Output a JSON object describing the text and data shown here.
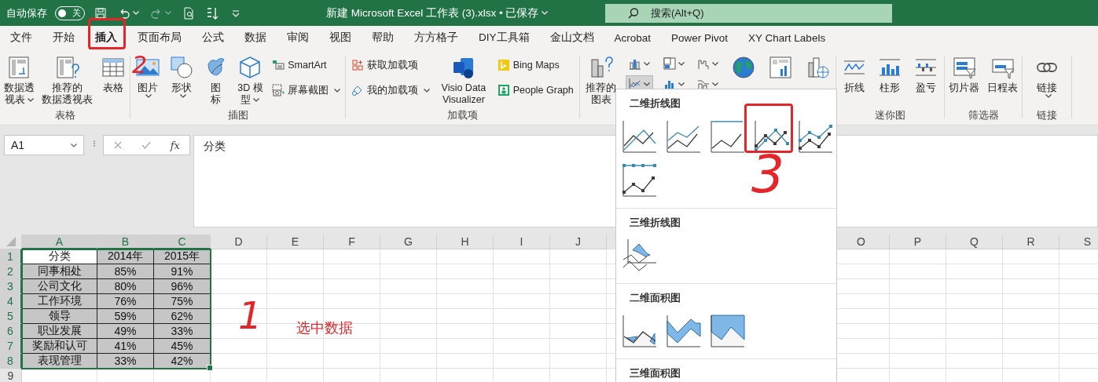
{
  "title_bar": {
    "autosave_label": "自动保存",
    "autosave": {
      "on": false,
      "label": "关"
    },
    "quick_access": [
      {
        "kind": "save",
        "disabled": false
      },
      {
        "kind": "undo",
        "disabled": false
      },
      {
        "kind": "redo",
        "disabled": true
      },
      {
        "kind": "document",
        "disabled": false
      },
      {
        "kind": "sort",
        "disabled": false
      },
      {
        "kind": "customize",
        "disabled": false
      }
    ],
    "title": "新建 Microsoft Excel 工作表 (3).xlsx • 已保存",
    "search": {
      "placeholder": "搜索(Alt+Q)"
    }
  },
  "tabs": [
    {
      "label": "文件",
      "selected": false
    },
    {
      "label": "开始",
      "selected": false
    },
    {
      "label": "插入",
      "selected": true
    },
    {
      "label": "页面布局",
      "selected": false
    },
    {
      "label": "公式",
      "selected": false
    },
    {
      "label": "数据",
      "selected": false
    },
    {
      "label": "审阅",
      "selected": false
    },
    {
      "label": "视图",
      "selected": false
    },
    {
      "label": "帮助",
      "selected": false
    },
    {
      "label": "方方格子",
      "selected": false
    },
    {
      "label": "DIY工具箱",
      "selected": false
    },
    {
      "label": "金山文档",
      "selected": false
    },
    {
      "label": "Acrobat",
      "selected": false
    },
    {
      "label": "Power Pivot",
      "selected": false
    },
    {
      "label": "XY Chart Labels",
      "selected": false
    }
  ],
  "ribbon": {
    "groups": [
      {
        "label": "表格",
        "columns": [
          {
            "kind": "large",
            "lines": [
              "数据透",
              "视表"
            ],
            "dropdown": true
          },
          {
            "kind": "large",
            "lines": [
              "推荐的",
              "数据透视表"
            ]
          },
          {
            "kind": "large",
            "lines": [
              "表格"
            ]
          }
        ]
      },
      {
        "label": "插图",
        "columns": [
          {
            "kind": "large",
            "lines": [
              "图片"
            ],
            "dropdown": true
          },
          {
            "kind": "large",
            "lines": [
              "形状"
            ],
            "dropdown": true
          },
          {
            "kind": "large",
            "lines": [
              "图",
              "标"
            ]
          },
          {
            "kind": "large",
            "lines": [
              "3D 模",
              "型"
            ],
            "dropdown": true
          },
          {
            "kind": "stack",
            "items": [
              {
                "label": "SmartArt"
              },
              {
                "label": "屏幕截图",
                "dropdown": true
              }
            ]
          }
        ]
      },
      {
        "label": "加载项",
        "columns": [
          {
            "kind": "stack",
            "items": [
              {
                "label": "获取加载项"
              },
              {
                "label": "我的加载项",
                "dropdown": true
              }
            ]
          },
          {
            "kind": "large",
            "lines": [
              "Visio Data",
              "Visualizer"
            ]
          },
          {
            "kind": "stack",
            "items": [
              {
                "label": "Bing Maps"
              },
              {
                "label": "People Graph"
              }
            ]
          }
        ]
      },
      {
        "columns": [
          {
            "kind": "large",
            "lines": [
              "推荐的",
              "图表"
            ]
          },
          {
            "kind": "icons",
            "items": [
              {
                "pressed": false
              },
              {
                "pressed": true
              }
            ]
          },
          {
            "kind": "icons",
            "items": [
              {
                "pressed": false
              },
              {
                "pressed": false
              }
            ]
          },
          {
            "kind": "icons",
            "items": [
              {
                "pressed": false
              },
              {
                "pressed": false
              }
            ]
          },
          {
            "kind": "large"
          },
          {
            "kind": "large"
          },
          {
            "kind": "large"
          }
        ]
      },
      {
        "label": "迷你图",
        "columns": [
          {
            "kind": "large",
            "lines": [
              "折线"
            ]
          },
          {
            "kind": "large",
            "lines": [
              "柱形"
            ]
          },
          {
            "kind": "large",
            "lines": [
              "盈亏"
            ]
          }
        ]
      },
      {
        "label": "筛选器",
        "columns": [
          {
            "kind": "large",
            "lines": [
              "切片器"
            ]
          },
          {
            "kind": "large",
            "lines": [
              "日程表"
            ]
          }
        ]
      },
      {
        "label": "链接",
        "columns": [
          {
            "kind": "large",
            "lines": [
              "链接"
            ],
            "dropdown": true
          }
        ]
      }
    ]
  },
  "formula_bar": {
    "name_box": "A1",
    "function_label": "fx",
    "formula": "分类"
  },
  "sheet": {
    "columns": [
      {
        "label": "A",
        "selected": true
      },
      {
        "label": "B",
        "selected": true
      },
      {
        "label": "C",
        "selected": true
      },
      {
        "label": "D",
        "selected": false
      },
      {
        "label": "E",
        "selected": false
      },
      {
        "label": "F",
        "selected": false
      },
      {
        "label": "G",
        "selected": false
      },
      {
        "label": "H",
        "selected": false
      },
      {
        "label": "I",
        "selected": false
      },
      {
        "label": "J",
        "selected": false
      },
      {
        "label": "O",
        "selected": false
      },
      {
        "label": "P",
        "selected": false
      },
      {
        "label": "Q",
        "selected": false
      },
      {
        "label": "R",
        "selected": false
      },
      {
        "label": "S",
        "selected": false
      }
    ],
    "rows": [
      {
        "number": "1",
        "selected": true,
        "cells": [
          "分类",
          "2014年",
          "2015年"
        ]
      },
      {
        "number": "2",
        "selected": true,
        "cells": [
          "同事相处",
          "85%",
          "91%"
        ]
      },
      {
        "number": "3",
        "selected": true,
        "cells": [
          "公司文化",
          "80%",
          "96%"
        ]
      },
      {
        "number": "4",
        "selected": true,
        "cells": [
          "工作环境",
          "76%",
          "75%"
        ]
      },
      {
        "number": "5",
        "selected": true,
        "cells": [
          "领导",
          "59%",
          "62%"
        ]
      },
      {
        "number": "6",
        "selected": true,
        "cells": [
          "职业发展",
          "49%",
          "33%"
        ]
      },
      {
        "number": "7",
        "selected": true,
        "cells": [
          "奖励和认可",
          "41%",
          "45%"
        ]
      },
      {
        "number": "8",
        "selected": true,
        "cells": [
          "表现管理",
          "33%",
          "42%"
        ]
      },
      {
        "number": "9",
        "selected": false
      }
    ]
  },
  "chart_menu": {
    "sections": [
      {
        "title": "二维折线图",
        "options": [
          {
            "kind": "line"
          },
          {
            "kind": "stacked-line"
          },
          {
            "kind": "percent-line"
          },
          {
            "kind": "line-markers"
          },
          {
            "kind": "stacked-line-markers"
          },
          {
            "kind": "percent-line-markers"
          }
        ]
      },
      {
        "title": "三维折线图",
        "options": [
          {
            "kind": "line3d"
          }
        ]
      },
      {
        "title": "二维面积图",
        "options": [
          {
            "kind": "area"
          },
          {
            "kind": "stacked-area"
          },
          {
            "kind": "percent-area"
          }
        ]
      },
      {
        "title": "三维面积图"
      }
    ]
  },
  "annotations": [
    {
      "kind": "box"
    },
    {
      "kind": "number",
      "text": "2"
    },
    {
      "kind": "box"
    },
    {
      "kind": "number",
      "text": "3"
    },
    {
      "kind": "number",
      "text": "1"
    },
    {
      "kind": "note",
      "text": "选中数据"
    }
  ]
}
